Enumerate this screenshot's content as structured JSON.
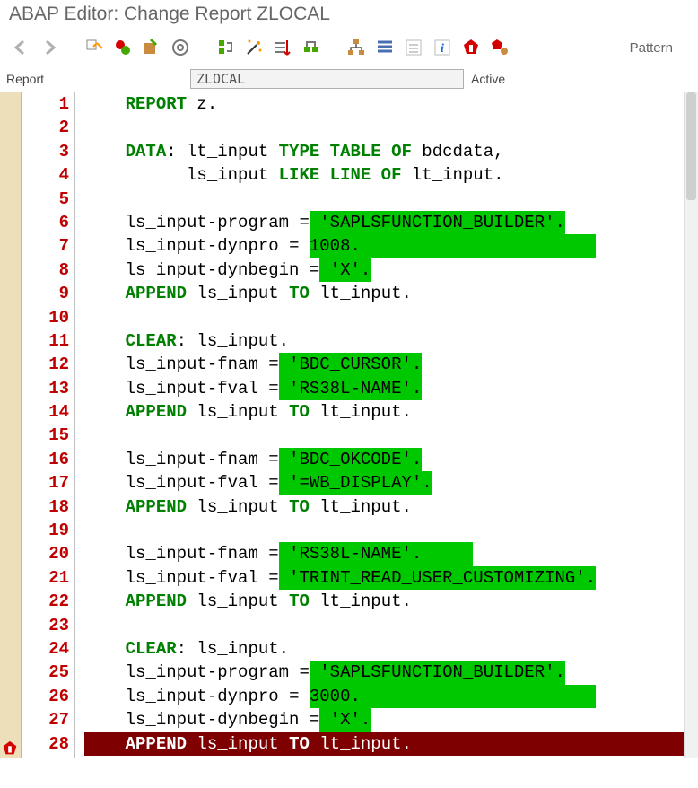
{
  "title": "ABAP Editor: Change Report ZLOCAL",
  "toolbar": {
    "back": "←",
    "forward": "→",
    "pattern_label": "Pattern"
  },
  "report_row": {
    "label": "Report",
    "value": "ZLOCAL",
    "status": "Active"
  },
  "line_count": 28,
  "code": [
    {
      "hl_line": false,
      "segs": [
        {
          "cls": "indent",
          "t": "    "
        },
        {
          "cls": "kw",
          "t": "REPORT"
        },
        {
          "cls": "name",
          "t": " z"
        },
        {
          "cls": "punct",
          "t": "."
        }
      ]
    },
    {
      "hl_line": false,
      "segs": []
    },
    {
      "hl_line": false,
      "segs": [
        {
          "cls": "indent",
          "t": "    "
        },
        {
          "cls": "kw",
          "t": "DATA"
        },
        {
          "cls": "punct",
          "t": ":"
        },
        {
          "cls": "name",
          "t": " lt_input "
        },
        {
          "cls": "kw",
          "t": "TYPE TABLE OF"
        },
        {
          "cls": "name",
          "t": " bdcdata"
        },
        {
          "cls": "punct",
          "t": ","
        }
      ]
    },
    {
      "hl_line": false,
      "segs": [
        {
          "cls": "indent",
          "t": "          "
        },
        {
          "cls": "name",
          "t": "ls_input "
        },
        {
          "cls": "kw",
          "t": "LIKE LINE OF"
        },
        {
          "cls": "name",
          "t": " lt_input"
        },
        {
          "cls": "punct",
          "t": "."
        }
      ]
    },
    {
      "hl_line": false,
      "segs": []
    },
    {
      "hl_line": false,
      "segs": [
        {
          "cls": "indent",
          "t": "    "
        },
        {
          "cls": "name",
          "t": "ls_input"
        },
        {
          "cls": "punct",
          "t": "-"
        },
        {
          "cls": "name",
          "t": "program "
        },
        {
          "cls": "punct",
          "t": "="
        },
        {
          "cls": "hl",
          "t": " 'SAPLSFUNCTION_BUILDER'."
        }
      ]
    },
    {
      "hl_line": false,
      "segs": [
        {
          "cls": "indent",
          "t": "    "
        },
        {
          "cls": "name",
          "t": "ls_input"
        },
        {
          "cls": "punct",
          "t": "-"
        },
        {
          "cls": "name",
          "t": "dynpro "
        },
        {
          "cls": "punct",
          "t": "= "
        },
        {
          "cls": "hl",
          "t": "1008.                       "
        }
      ]
    },
    {
      "hl_line": false,
      "segs": [
        {
          "cls": "indent",
          "t": "    "
        },
        {
          "cls": "name",
          "t": "ls_input"
        },
        {
          "cls": "punct",
          "t": "-"
        },
        {
          "cls": "name",
          "t": "dynbegin "
        },
        {
          "cls": "punct",
          "t": "="
        },
        {
          "cls": "hl",
          "t": " 'X'."
        }
      ]
    },
    {
      "hl_line": false,
      "segs": [
        {
          "cls": "indent",
          "t": "    "
        },
        {
          "cls": "kw",
          "t": "APPEND"
        },
        {
          "cls": "name",
          "t": " ls_input "
        },
        {
          "cls": "kw",
          "t": "TO"
        },
        {
          "cls": "name",
          "t": " lt_input"
        },
        {
          "cls": "punct",
          "t": "."
        }
      ]
    },
    {
      "hl_line": false,
      "segs": []
    },
    {
      "hl_line": false,
      "segs": [
        {
          "cls": "indent",
          "t": "    "
        },
        {
          "cls": "kw",
          "t": "CLEAR"
        },
        {
          "cls": "punct",
          "t": ":"
        },
        {
          "cls": "name",
          "t": " ls_input"
        },
        {
          "cls": "punct",
          "t": "."
        }
      ]
    },
    {
      "hl_line": false,
      "segs": [
        {
          "cls": "indent",
          "t": "    "
        },
        {
          "cls": "name",
          "t": "ls_input"
        },
        {
          "cls": "punct",
          "t": "-"
        },
        {
          "cls": "name",
          "t": "fnam "
        },
        {
          "cls": "punct",
          "t": "="
        },
        {
          "cls": "hl",
          "t": " 'BDC_CURSOR'."
        }
      ]
    },
    {
      "hl_line": false,
      "segs": [
        {
          "cls": "indent",
          "t": "    "
        },
        {
          "cls": "name",
          "t": "ls_input"
        },
        {
          "cls": "punct",
          "t": "-"
        },
        {
          "cls": "name",
          "t": "fval "
        },
        {
          "cls": "punct",
          "t": "="
        },
        {
          "cls": "hl",
          "t": " 'RS38L-NAME'."
        }
      ]
    },
    {
      "hl_line": false,
      "segs": [
        {
          "cls": "indent",
          "t": "    "
        },
        {
          "cls": "kw",
          "t": "APPEND"
        },
        {
          "cls": "name",
          "t": " ls_input "
        },
        {
          "cls": "kw",
          "t": "TO"
        },
        {
          "cls": "name",
          "t": " lt_input"
        },
        {
          "cls": "punct",
          "t": "."
        }
      ]
    },
    {
      "hl_line": false,
      "segs": []
    },
    {
      "hl_line": false,
      "segs": [
        {
          "cls": "indent",
          "t": "    "
        },
        {
          "cls": "name",
          "t": "ls_input"
        },
        {
          "cls": "punct",
          "t": "-"
        },
        {
          "cls": "name",
          "t": "fnam "
        },
        {
          "cls": "punct",
          "t": "="
        },
        {
          "cls": "hl",
          "t": " 'BDC_OKCODE'."
        }
      ]
    },
    {
      "hl_line": false,
      "segs": [
        {
          "cls": "indent",
          "t": "    "
        },
        {
          "cls": "name",
          "t": "ls_input"
        },
        {
          "cls": "punct",
          "t": "-"
        },
        {
          "cls": "name",
          "t": "fval "
        },
        {
          "cls": "punct",
          "t": "="
        },
        {
          "cls": "hl",
          "t": " '=WB_DISPLAY'."
        }
      ]
    },
    {
      "hl_line": false,
      "segs": [
        {
          "cls": "indent",
          "t": "    "
        },
        {
          "cls": "kw",
          "t": "APPEND"
        },
        {
          "cls": "name",
          "t": " ls_input "
        },
        {
          "cls": "kw",
          "t": "TO"
        },
        {
          "cls": "name",
          "t": " lt_input"
        },
        {
          "cls": "punct",
          "t": "."
        }
      ]
    },
    {
      "hl_line": false,
      "segs": []
    },
    {
      "hl_line": false,
      "segs": [
        {
          "cls": "indent",
          "t": "    "
        },
        {
          "cls": "name",
          "t": "ls_input"
        },
        {
          "cls": "punct",
          "t": "-"
        },
        {
          "cls": "name",
          "t": "fnam "
        },
        {
          "cls": "punct",
          "t": "="
        },
        {
          "cls": "hl",
          "t": " 'RS38L-NAME'.     "
        }
      ]
    },
    {
      "hl_line": false,
      "segs": [
        {
          "cls": "indent",
          "t": "    "
        },
        {
          "cls": "name",
          "t": "ls_input"
        },
        {
          "cls": "punct",
          "t": "-"
        },
        {
          "cls": "name",
          "t": "fval "
        },
        {
          "cls": "punct",
          "t": "="
        },
        {
          "cls": "hl",
          "t": " 'TRINT_READ_USER_CUSTOMIZING'."
        }
      ]
    },
    {
      "hl_line": false,
      "segs": [
        {
          "cls": "indent",
          "t": "    "
        },
        {
          "cls": "kw",
          "t": "APPEND"
        },
        {
          "cls": "name",
          "t": " ls_input "
        },
        {
          "cls": "kw",
          "t": "TO"
        },
        {
          "cls": "name",
          "t": " lt_input"
        },
        {
          "cls": "punct",
          "t": "."
        }
      ]
    },
    {
      "hl_line": false,
      "segs": []
    },
    {
      "hl_line": false,
      "segs": [
        {
          "cls": "indent",
          "t": "    "
        },
        {
          "cls": "kw",
          "t": "CLEAR"
        },
        {
          "cls": "punct",
          "t": ":"
        },
        {
          "cls": "name",
          "t": " ls_input"
        },
        {
          "cls": "punct",
          "t": "."
        }
      ]
    },
    {
      "hl_line": false,
      "segs": [
        {
          "cls": "indent",
          "t": "    "
        },
        {
          "cls": "name",
          "t": "ls_input"
        },
        {
          "cls": "punct",
          "t": "-"
        },
        {
          "cls": "name",
          "t": "program "
        },
        {
          "cls": "punct",
          "t": "="
        },
        {
          "cls": "hl",
          "t": " 'SAPLSFUNCTION_BUILDER'."
        }
      ]
    },
    {
      "hl_line": false,
      "segs": [
        {
          "cls": "indent",
          "t": "    "
        },
        {
          "cls": "name",
          "t": "ls_input"
        },
        {
          "cls": "punct",
          "t": "-"
        },
        {
          "cls": "name",
          "t": "dynpro "
        },
        {
          "cls": "punct",
          "t": "= "
        },
        {
          "cls": "hl",
          "t": "3000.                       "
        }
      ]
    },
    {
      "hl_line": false,
      "segs": [
        {
          "cls": "indent",
          "t": "    "
        },
        {
          "cls": "name",
          "t": "ls_input"
        },
        {
          "cls": "punct",
          "t": "-"
        },
        {
          "cls": "name",
          "t": "dynbegin "
        },
        {
          "cls": "punct",
          "t": "="
        },
        {
          "cls": "hl",
          "t": " 'X'."
        }
      ]
    },
    {
      "hl_line": true,
      "segs": [
        {
          "cls": "indent",
          "t": "    "
        },
        {
          "cls": "kw",
          "t": "APPEND"
        },
        {
          "cls": "name",
          "t": " ls_input "
        },
        {
          "cls": "kw",
          "t": "TO"
        },
        {
          "cls": "name",
          "t": " lt_input"
        },
        {
          "cls": "punct",
          "t": ".                               "
        }
      ]
    }
  ]
}
